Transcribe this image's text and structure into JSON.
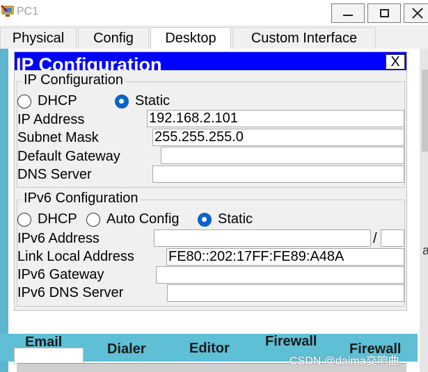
{
  "window": {
    "title": "PC1"
  },
  "tabs": [
    {
      "label": "Physical"
    },
    {
      "label": "Config"
    },
    {
      "label": "Desktop"
    },
    {
      "label": "Custom Interface"
    }
  ],
  "background": {
    "app_labels": [
      "Email",
      "Dialer",
      "Editor",
      "Firewall",
      "Firewall"
    ],
    "side_glyph": "a",
    "watermark": "CSDN @daima交响曲"
  },
  "dialog": {
    "title": "IP Configuration",
    "close_label": "X",
    "ipv4": {
      "legend": "IP Configuration",
      "dhcp_label": "DHCP",
      "static_label": "Static",
      "selected": "Static",
      "fields": {
        "ip_address": {
          "label": "IP Address",
          "value": "192.168.2.101"
        },
        "subnet_mask": {
          "label": "Subnet Mask",
          "value": "255.255.255.0"
        },
        "default_gateway": {
          "label": "Default Gateway",
          "value": ""
        },
        "dns_server": {
          "label": "DNS Server",
          "value": ""
        }
      }
    },
    "ipv6": {
      "legend": "IPv6 Configuration",
      "dhcp_label": "DHCP",
      "auto_label": "Auto Config",
      "static_label": "Static",
      "selected": "Static",
      "prefix_separator": "/",
      "fields": {
        "ipv6_address": {
          "label": "IPv6 Address",
          "value": "",
          "prefix": ""
        },
        "link_local": {
          "label": "Link Local Address",
          "value": "FE80::202:17FF:FE89:A48A"
        },
        "ipv6_gateway": {
          "label": "IPv6 Gateway",
          "value": ""
        },
        "ipv6_dns": {
          "label": "IPv6 DNS Server",
          "value": ""
        }
      }
    }
  },
  "colors": {
    "dialog_title_bg": "#0000ff",
    "desktop_accent": "#5fb5cf",
    "radio_selected": "#0a64c8"
  }
}
